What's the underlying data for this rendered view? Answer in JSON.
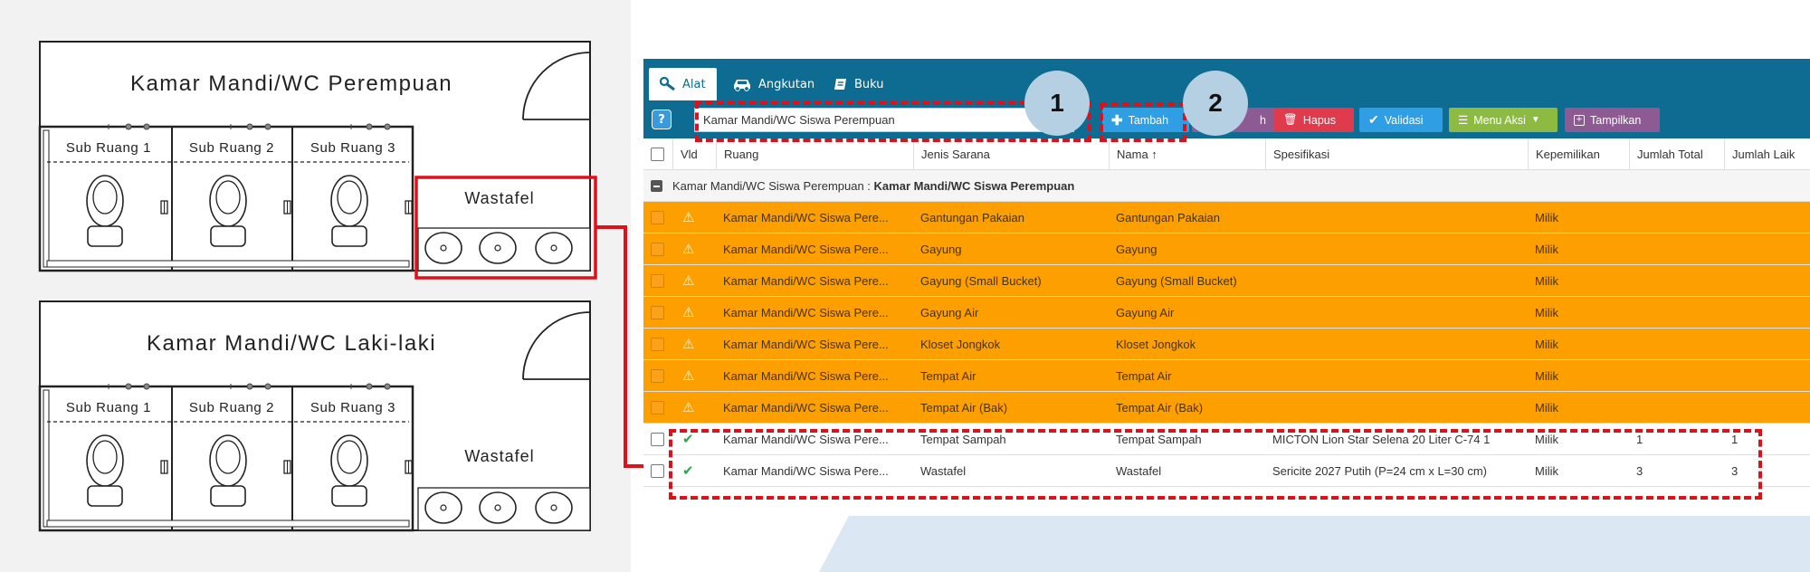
{
  "floorplan": {
    "women": {
      "title": "Kamar Mandi/WC Perempuan",
      "rooms": [
        "Sub Ruang 1",
        "Sub Ruang 2",
        "Sub Ruang 3"
      ],
      "sink_label": "Wastafel"
    },
    "men": {
      "title": "Kamar Mandi/WC Laki-laki",
      "rooms": [
        "Sub Ruang 1",
        "Sub Ruang 2",
        "Sub Ruang 3"
      ],
      "sink_label": "Wastafel"
    }
  },
  "tabs": [
    {
      "label": "Alat",
      "icon": "wrench-icon"
    },
    {
      "label": "Angkutan",
      "icon": "car-icon"
    },
    {
      "label": "Buku",
      "icon": "book-icon"
    }
  ],
  "toolbar": {
    "help": "?",
    "search_value": "Kamar Mandi/WC Siswa Perempuan",
    "add": "Tambah",
    "delete": "Hapus",
    "validate": "Validasi",
    "action_menu": "Menu Aksi",
    "show": "Tampilkan",
    "partial_hidden": "h"
  },
  "columns": [
    "Vld",
    "Ruang",
    "Jenis Sarana",
    "Nama ↑",
    "Spesifikasi",
    "Kepemilikan",
    "Jumlah Total",
    "Jumlah Laik"
  ],
  "group": {
    "label": "Kamar Mandi/WC Siswa Perempuan : ",
    "bold": "Kamar Mandi/WC Siswa Perempuan"
  },
  "rows": [
    {
      "status": "warn",
      "ruang": "Kamar Mandi/WC Siswa Pere...",
      "jenis": "Gantungan Pakaian",
      "nama": "Gantungan Pakaian",
      "spek": "",
      "milik": "Milik",
      "total": "",
      "laik": ""
    },
    {
      "status": "warn",
      "ruang": "Kamar Mandi/WC Siswa Pere...",
      "jenis": "Gayung",
      "nama": "Gayung",
      "spek": "",
      "milik": "Milik",
      "total": "",
      "laik": ""
    },
    {
      "status": "warn",
      "ruang": "Kamar Mandi/WC Siswa Pere...",
      "jenis": "Gayung (Small Bucket)",
      "nama": "Gayung (Small Bucket)",
      "spek": "",
      "milik": "Milik",
      "total": "",
      "laik": ""
    },
    {
      "status": "warn",
      "ruang": "Kamar Mandi/WC Siswa Pere...",
      "jenis": "Gayung Air",
      "nama": "Gayung Air",
      "spek": "",
      "milik": "Milik",
      "total": "",
      "laik": ""
    },
    {
      "status": "warn",
      "ruang": "Kamar Mandi/WC Siswa Pere...",
      "jenis": "Kloset Jongkok",
      "nama": "Kloset Jongkok",
      "spek": "",
      "milik": "Milik",
      "total": "",
      "laik": ""
    },
    {
      "status": "warn",
      "ruang": "Kamar Mandi/WC Siswa Pere...",
      "jenis": "Tempat Air",
      "nama": "Tempat Air",
      "spek": "",
      "milik": "Milik",
      "total": "",
      "laik": ""
    },
    {
      "status": "warn",
      "ruang": "Kamar Mandi/WC Siswa Pere...",
      "jenis": "Tempat Air (Bak)",
      "nama": "Tempat Air (Bak)",
      "spek": "",
      "milik": "Milik",
      "total": "",
      "laik": ""
    },
    {
      "status": "ok",
      "ruang": "Kamar Mandi/WC Siswa Pere...",
      "jenis": "Tempat Sampah",
      "nama": "Tempat Sampah",
      "spek": "MICTON Lion Star Selena 20 Liter C-74 1",
      "milik": "Milik",
      "total": "1",
      "laik": "1"
    },
    {
      "status": "ok",
      "ruang": "Kamar Mandi/WC Siswa Pere...",
      "jenis": "Wastafel",
      "nama": "Wastafel",
      "spek": "Sericite 2027 Putih (P=24 cm x L=30 cm)",
      "milik": "Milik",
      "total": "3",
      "laik": "3"
    }
  ],
  "callouts": [
    "1",
    "2"
  ],
  "colors": {
    "header": "#0e6b91",
    "warning_row": "#fe9f00",
    "highlight": "#e0101a",
    "add_button": "#2f9ee2",
    "delete_button": "#e03a4d",
    "validate_button": "#2f9ee2",
    "menu_button": "#8dbb42",
    "show_button": "#8d5a93"
  }
}
